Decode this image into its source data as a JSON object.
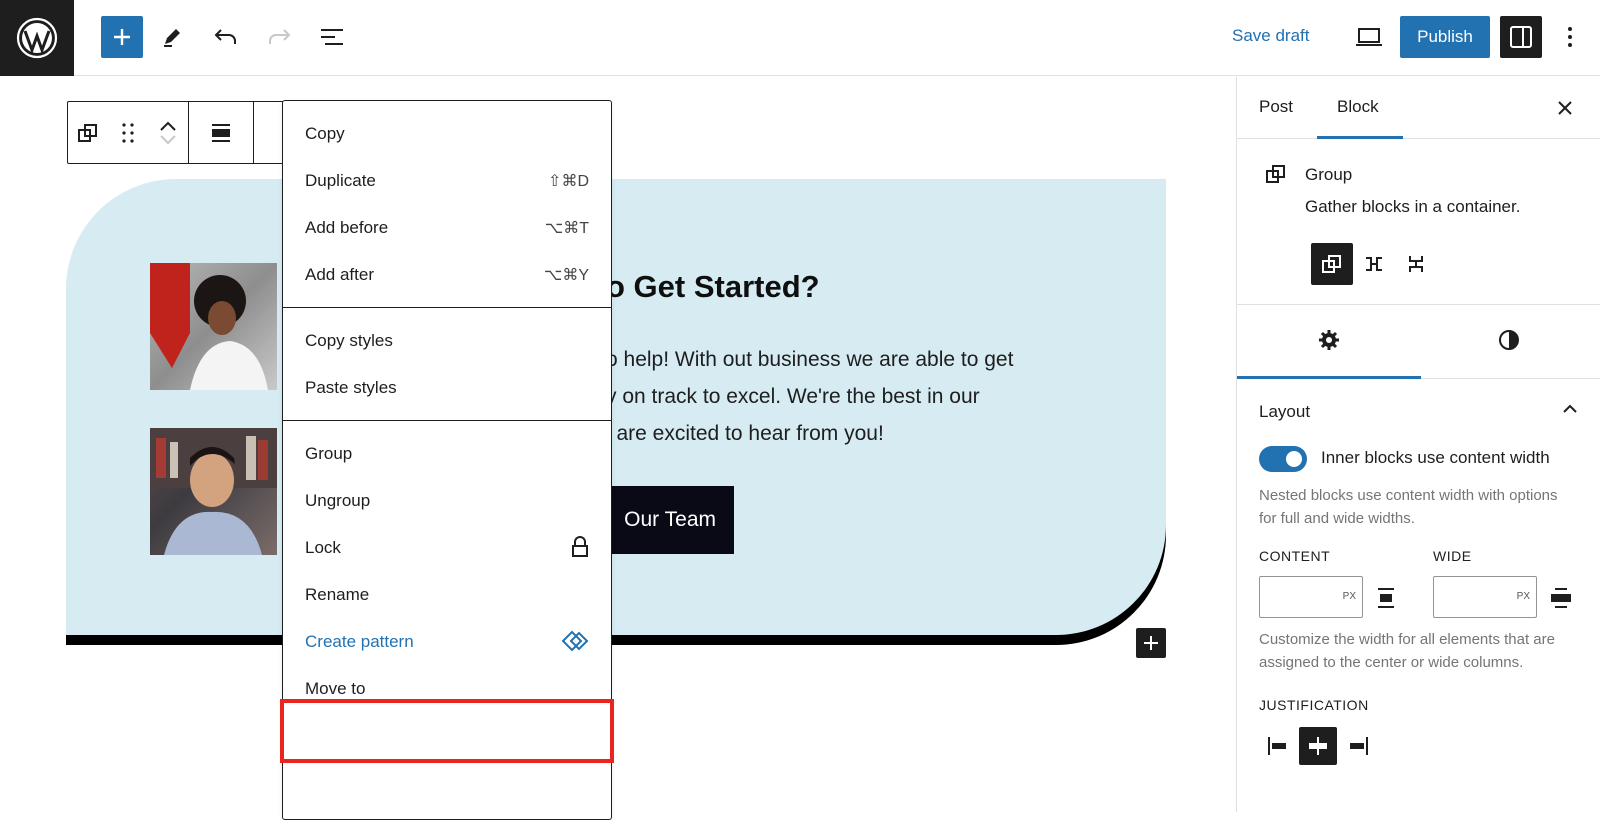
{
  "topbar": {
    "save_draft": "Save draft",
    "publish": "Publish",
    "icons": [
      "wordpress-logo",
      "plus-icon",
      "pencil-icon",
      "undo-icon",
      "redo-icon",
      "list-view-icon",
      "desktop-preview-icon",
      "sidebar-toggle-icon",
      "more-vertical-icon"
    ],
    "accent": "#2271b1"
  },
  "block_toolbar": {
    "icons": [
      "group-icon",
      "drag-handle-icon",
      "move-up-icon",
      "move-down-icon",
      "align-icon",
      "more-options-icon"
    ]
  },
  "hero": {
    "title": "o Get Started?",
    "text_lines": [
      "o help! With out business we are able to get",
      "y on track to excel. We're the best in our",
      "l are excited to hear from you!"
    ],
    "button": "Our Team",
    "bg_color": "#d6ebf2"
  },
  "menu": {
    "sections": [
      [
        {
          "label": "Copy",
          "shortcut": ""
        },
        {
          "label": "Duplicate",
          "shortcut": "⇧⌘D"
        },
        {
          "label": "Add before",
          "shortcut": "⌥⌘T"
        },
        {
          "label": "Add after",
          "shortcut": "⌥⌘Y"
        }
      ],
      [
        {
          "label": "Copy styles",
          "shortcut": ""
        },
        {
          "label": "Paste styles",
          "shortcut": ""
        }
      ],
      [
        {
          "label": "Group",
          "shortcut": ""
        },
        {
          "label": "Ungroup",
          "shortcut": ""
        },
        {
          "label": "Lock",
          "shortcut": ""
        },
        {
          "label": "Rename",
          "shortcut": ""
        },
        {
          "label": "Create pattern",
          "shortcut": ""
        },
        {
          "label": "Move to",
          "shortcut": ""
        }
      ]
    ],
    "highlight_color": "#e8261d"
  },
  "sidebar": {
    "tabs": [
      "Post",
      "Block"
    ],
    "block": {
      "title": "Group",
      "description": "Gather blocks in a container."
    },
    "layout": {
      "heading": "Layout",
      "toggle_label": "Inner blocks use content width",
      "toggle_on": true,
      "help1": "Nested blocks use content width with options for full and wide widths.",
      "content_label": "CONTENT",
      "wide_label": "WIDE",
      "unit": "PX",
      "help2": "Customize the width for all elements that are assigned to the center or wide columns.",
      "justification_label": "JUSTIFICATION"
    }
  }
}
